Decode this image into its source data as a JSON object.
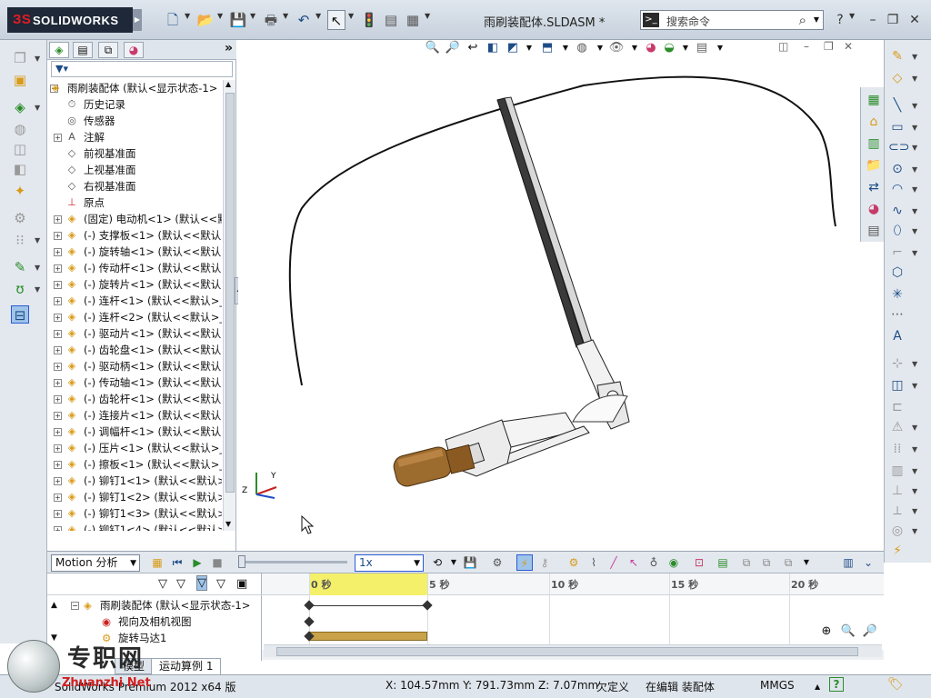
{
  "app": {
    "brand": "SOLIDWORKS",
    "document_title": "雨刷装配体.SLDASM *"
  },
  "search": {
    "placeholder": "搜索命令"
  },
  "feature_tree": {
    "root": "雨刷装配体 (默认<显示状态-1>",
    "items": [
      {
        "pm": "",
        "icon": "history",
        "label": "历史记录"
      },
      {
        "pm": "",
        "icon": "sensor",
        "label": "传感器"
      },
      {
        "pm": "+",
        "icon": "annotation",
        "label": "注解"
      },
      {
        "pm": "",
        "icon": "plane",
        "label": "前视基准面"
      },
      {
        "pm": "",
        "icon": "plane",
        "label": "上视基准面"
      },
      {
        "pm": "",
        "icon": "plane",
        "label": "右视基准面"
      },
      {
        "pm": "",
        "icon": "origin",
        "label": "原点"
      },
      {
        "pm": "+",
        "icon": "part",
        "label": "(固定) 电动机<1> (默认<<默"
      },
      {
        "pm": "+",
        "icon": "part",
        "label": "(-) 支撑板<1> (默认<<默认"
      },
      {
        "pm": "+",
        "icon": "part",
        "label": "(-) 旋转轴<1> (默认<<默认"
      },
      {
        "pm": "+",
        "icon": "part",
        "label": "(-) 传动杆<1> (默认<<默认"
      },
      {
        "pm": "+",
        "icon": "part",
        "label": "(-) 旋转片<1> (默认<<默认"
      },
      {
        "pm": "+",
        "icon": "part",
        "label": "(-) 连杆<1> (默认<<默认>_"
      },
      {
        "pm": "+",
        "icon": "part",
        "label": "(-) 连杆<2> (默认<<默认>_"
      },
      {
        "pm": "+",
        "icon": "part",
        "label": "(-) 驱动片<1> (默认<<默认"
      },
      {
        "pm": "+",
        "icon": "part",
        "label": "(-) 齿轮盘<1> (默认<<默认"
      },
      {
        "pm": "+",
        "icon": "part",
        "label": "(-) 驱动柄<1> (默认<<默认"
      },
      {
        "pm": "+",
        "icon": "part",
        "label": "(-) 传动轴<1> (默认<<默认"
      },
      {
        "pm": "+",
        "icon": "part",
        "label": "(-) 齿轮杆<1> (默认<<默认"
      },
      {
        "pm": "+",
        "icon": "part",
        "label": "(-) 连接片<1> (默认<<默认"
      },
      {
        "pm": "+",
        "icon": "part",
        "label": "(-) 调幅杆<1> (默认<<默认"
      },
      {
        "pm": "+",
        "icon": "part",
        "label": "(-) 压片<1> (默认<<默认>_"
      },
      {
        "pm": "+",
        "icon": "part",
        "label": "(-) 擦板<1> (默认<<默认>_"
      },
      {
        "pm": "+",
        "icon": "part",
        "label": "(-) 铆钉1<1> (默认<<默认>"
      },
      {
        "pm": "+",
        "icon": "part",
        "label": "(-) 铆钉1<2> (默认<<默认>"
      },
      {
        "pm": "+",
        "icon": "part",
        "label": "(-) 铆钉1<3> (默认<<默认>"
      },
      {
        "pm": "+",
        "icon": "part",
        "label": "(-) 铆钉1<4> (默认<<默认>"
      }
    ]
  },
  "motion": {
    "study_type": "Motion 分析",
    "speed": "1x",
    "timeline_labels": [
      "0 秒",
      "5 秒",
      "10 秒",
      "15 秒",
      "20 秒"
    ],
    "tree_root": "雨刷装配体 (默认<显示状态-1>",
    "tree_items": [
      "视向及相机视图",
      "旋转马达1"
    ]
  },
  "bottom_tabs": [
    "模型",
    "运动算例 1"
  ],
  "status": {
    "version": "SolidWorks Premium 2012 x64 版",
    "coords": "X: 104.57mm Y: 791.73mm Z: 7.07mm",
    "definition": "欠定义",
    "editing": "在编辑 装配体",
    "units": "MMGS",
    "help": "?"
  },
  "watermark": {
    "cn": "专职网",
    "en": "Zhuanzhi Net"
  },
  "colors": {
    "accent": "#1d4c86",
    "timeline_highlight": "#f5f06a",
    "motor_bar": "#c9a24a",
    "motor_body": "#9c6b2e"
  }
}
